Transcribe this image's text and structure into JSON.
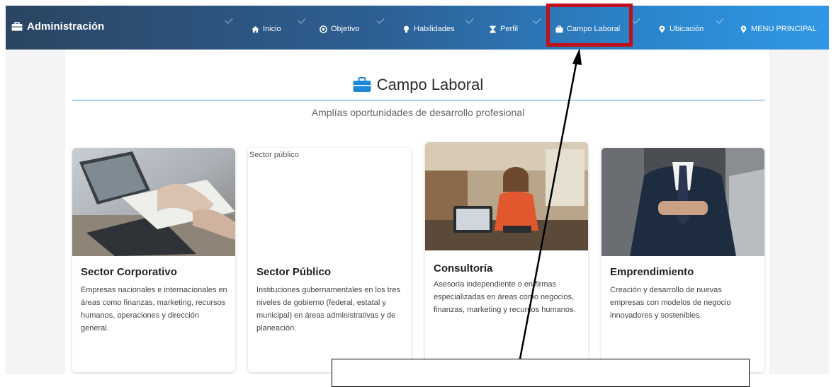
{
  "navbar": {
    "brand": "Administración",
    "items": [
      {
        "label": "Inicio",
        "icon": "home-icon"
      },
      {
        "label": "Objetivo",
        "icon": "target-icon"
      },
      {
        "label": "Habilidades",
        "icon": "lightbulb-icon"
      },
      {
        "label": "Perfil",
        "icon": "hourglass-icon"
      },
      {
        "label": "Campo Laboral",
        "icon": "briefcase-icon"
      },
      {
        "label": "Ubicación",
        "icon": "location-pin-icon"
      },
      {
        "label": "MENU PRINCIPAL",
        "icon": "location-pin-icon"
      }
    ]
  },
  "section": {
    "title": "Campo Laboral",
    "subtitle": "Amplías oportunidades de desarrollo profesional"
  },
  "cards": [
    {
      "title": "Sector Corporativo",
      "text": "Empresas nacionales e internacionales en áreas como finanzas, marketing, recursos humanos, operaciones y dirección general."
    },
    {
      "title": "Sector Público",
      "alt": "Sector público",
      "text": "Instituciones gubernamentales en los tres niveles de gobierno (federal, estatal y municipal) en áreas administrativas y de planeación."
    },
    {
      "title": "Consultoría",
      "text": "Asesoría independiente o en firmas especializadas en áreas como negocios, finanzas, marketing y recursos humanos."
    },
    {
      "title": "Emprendimiento",
      "text": "Creación y desarrollo de nuevas empresas con modelos de negocio innovadores y sostenibles."
    }
  ],
  "colors": {
    "navbar_start": "#2b4562",
    "navbar_end": "#2f98e6",
    "accent": "#1e88d8",
    "highlight": "#c0101a"
  }
}
